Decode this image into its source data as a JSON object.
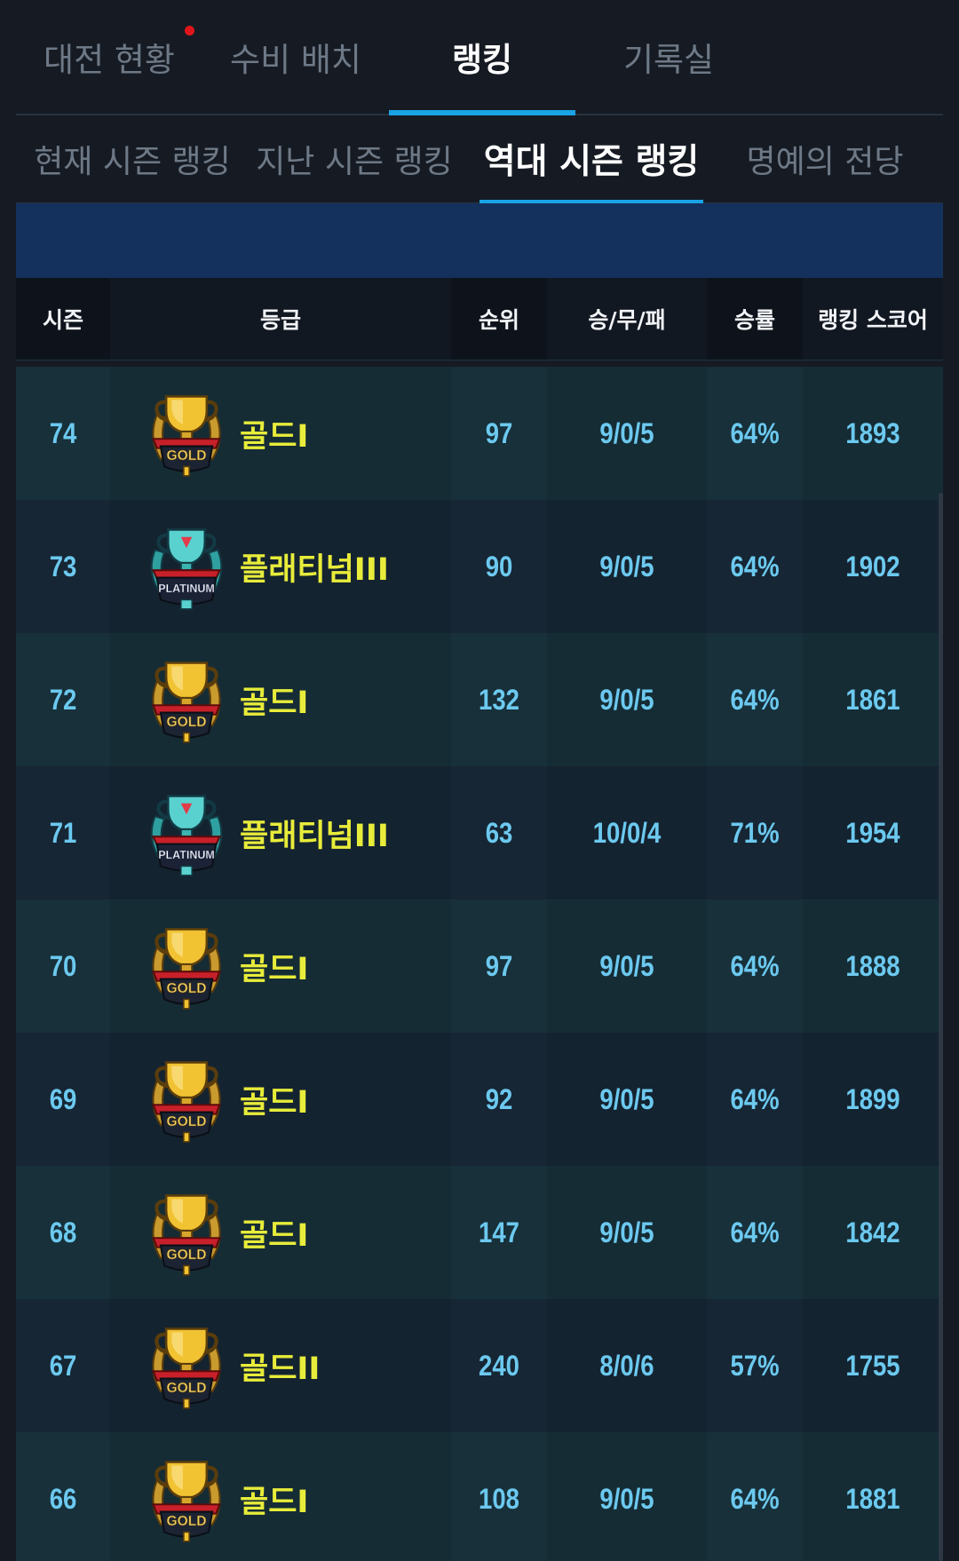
{
  "main_tabs": [
    {
      "label": "대전 현황",
      "has_notification": true
    },
    {
      "label": "수비 배치"
    },
    {
      "label": "랭킹",
      "active": true
    },
    {
      "label": "기록실"
    }
  ],
  "sub_tabs": [
    {
      "label": "현재 시즌 랭킹"
    },
    {
      "label": "지난 시즌 랭킹"
    },
    {
      "label": "역대 시즌 랭킹",
      "active": true
    },
    {
      "label": "명예의 전당"
    }
  ],
  "table": {
    "headers": {
      "season": "시즌",
      "tier": "등급",
      "rank": "순위",
      "record": "승/무/패",
      "win_rate": "승률",
      "score": "랭킹 스코어"
    },
    "rows": [
      {
        "season": "74",
        "emblem": "gold-trophy-icon",
        "tier": "골드I",
        "rank": "97",
        "record": "9/0/5",
        "win_rate": "64%",
        "score": "1893"
      },
      {
        "season": "73",
        "emblem": "platinum-trophy-icon",
        "tier": "플래티넘III",
        "rank": "90",
        "record": "9/0/5",
        "win_rate": "64%",
        "score": "1902"
      },
      {
        "season": "72",
        "emblem": "gold-trophy-icon",
        "tier": "골드I",
        "rank": "132",
        "record": "9/0/5",
        "win_rate": "64%",
        "score": "1861"
      },
      {
        "season": "71",
        "emblem": "platinum-trophy-icon",
        "tier": "플래티넘III",
        "rank": "63",
        "record": "10/0/4",
        "win_rate": "71%",
        "score": "1954"
      },
      {
        "season": "70",
        "emblem": "gold-trophy-icon",
        "tier": "골드I",
        "rank": "97",
        "record": "9/0/5",
        "win_rate": "64%",
        "score": "1888"
      },
      {
        "season": "69",
        "emblem": "gold-trophy-icon",
        "tier": "골드I",
        "rank": "92",
        "record": "9/0/5",
        "win_rate": "64%",
        "score": "1899"
      },
      {
        "season": "68",
        "emblem": "gold-trophy-icon",
        "tier": "골드I",
        "rank": "147",
        "record": "9/0/5",
        "win_rate": "64%",
        "score": "1842"
      },
      {
        "season": "67",
        "emblem": "gold-trophy-icon",
        "tier": "골드II",
        "rank": "240",
        "record": "8/0/6",
        "win_rate": "57%",
        "score": "1755"
      },
      {
        "season": "66",
        "emblem": "gold-trophy-icon",
        "tier": "골드I",
        "rank": "108",
        "record": "9/0/5",
        "win_rate": "64%",
        "score": "1881"
      }
    ]
  },
  "emblem_text": {
    "gold": "GOLD",
    "platinum": "PLATINUM"
  },
  "colors": {
    "accent": "#1aa3e6",
    "tier_text": "#e8ec3a",
    "value_text": "#6cc9ef",
    "banner": "#14305c",
    "row_even": "#17303a",
    "row_odd": "#162634",
    "notification": "#e0151b"
  }
}
